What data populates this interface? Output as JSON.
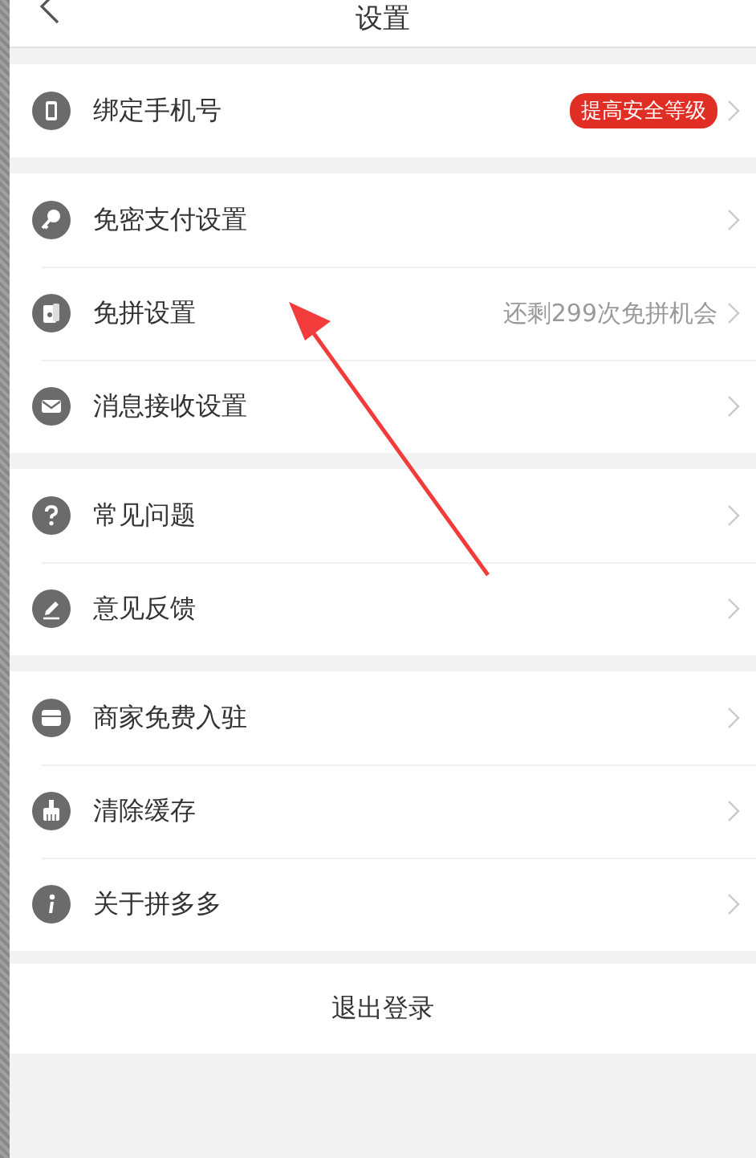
{
  "header": {
    "title": "设置"
  },
  "groups": [
    [
      {
        "label": "绑定手机号",
        "badge": "提高安全等级"
      }
    ],
    [
      {
        "label": "免密支付设置"
      },
      {
        "label": "免拼设置",
        "hint": "还剩299次免拼机会"
      },
      {
        "label": "消息接收设置"
      }
    ],
    [
      {
        "label": "常见问题"
      },
      {
        "label": "意见反馈"
      }
    ],
    [
      {
        "label": "商家免费入驻"
      },
      {
        "label": "清除缓存"
      },
      {
        "label": "关于拼多多"
      }
    ]
  ],
  "logout": "退出登录"
}
